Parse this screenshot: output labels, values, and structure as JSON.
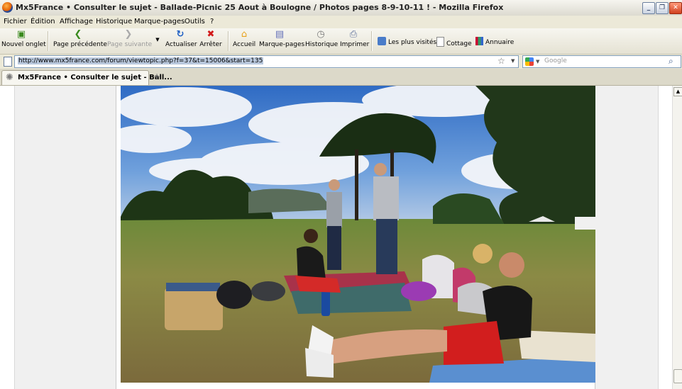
{
  "window": {
    "title": "Mx5France • Consulter le sujet - Ballade-Picnic 25 Aout à Boulogne / Photos pages 8-9-10-11 ! - Mozilla Firefox"
  },
  "menu": [
    "Fichier",
    "Édition",
    "Affichage",
    "Historique",
    "Marque-pages",
    "Outils",
    "?"
  ],
  "toolbar": {
    "new_tab": "Nouvel onglet",
    "back": "Page précédente",
    "forward": "Page suivante",
    "reload": "Actualiser",
    "stop": "Arrêter",
    "home": "Accueil",
    "bookmarks": "Marque-pages",
    "history": "Historique",
    "print": "Imprimer"
  },
  "bookmarks_bar": [
    "Les plus visités",
    "Cottage",
    "Annuaire"
  ],
  "url": "http://www.mx5france.com/forum/viewtopic.php?f=37&t=15006&start=135",
  "search": {
    "placeholder": "Google"
  },
  "tabs": [
    {
      "label": "Mx5France • Consulter le sujet - Ball..."
    }
  ],
  "colors": {
    "back_arrow": "#3a8a1e",
    "reload": "#1e5fc4",
    "stop": "#d21a1a",
    "home": "#e8a21c"
  }
}
